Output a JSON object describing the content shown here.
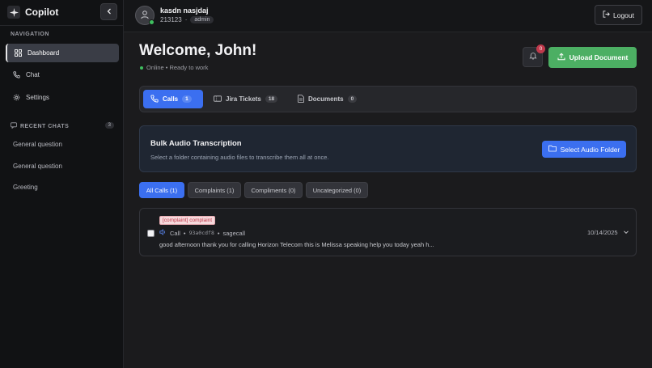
{
  "brand": {
    "name": "Copilot"
  },
  "sidebar": {
    "nav_title": "NAVIGATION",
    "items": [
      {
        "label": "Dashboard",
        "icon": "grid-icon",
        "active": true
      },
      {
        "label": "Chat",
        "icon": "phone-icon",
        "active": false
      },
      {
        "label": "Settings",
        "icon": "gear-icon",
        "active": false
      }
    ],
    "recent_title": "RECENT CHATS",
    "recent_count": "3",
    "recent": [
      "General question",
      "General question",
      "Greeting"
    ]
  },
  "user": {
    "name": "kasdn nasjdaj",
    "id": "213123",
    "role": "admin",
    "status_color": "#3fbf5f"
  },
  "header": {
    "logout_label": "Logout"
  },
  "main": {
    "welcome": "Welcome, John!",
    "status": "Online • Ready to work",
    "notification_count": "0",
    "upload_label": "Upload Document",
    "tabs": [
      {
        "label": "Calls",
        "count": "1",
        "icon": "phone-icon",
        "active": true
      },
      {
        "label": "Jira Tickets",
        "count": "18",
        "icon": "ticket-icon",
        "active": false
      },
      {
        "label": "Documents",
        "count": "0",
        "icon": "document-icon",
        "active": false
      }
    ],
    "bulk": {
      "title": "Bulk Audio Transcription",
      "description": "Select a folder containing audio files to transcribe them all at once.",
      "button_label": "Select Audio Folder"
    },
    "filters": [
      {
        "label": "All Calls (1)",
        "active": true
      },
      {
        "label": "Complaints (1)",
        "active": false
      },
      {
        "label": "Compliments (0)",
        "active": false
      },
      {
        "label": "Uncategorized (0)",
        "active": false
      }
    ],
    "calls": [
      {
        "tag": "[complaint] complaint",
        "type": "Call",
        "id": "93a0cdf8",
        "source": "sagecall",
        "date": "10/14/2025",
        "preview": "good afternoon thank you for calling Horizon Telecom this is Melissa speaking help you today yeah h..."
      }
    ]
  },
  "colors": {
    "accent": "#3b6ff0",
    "success": "#4caf63",
    "danger": "#c0394b"
  }
}
